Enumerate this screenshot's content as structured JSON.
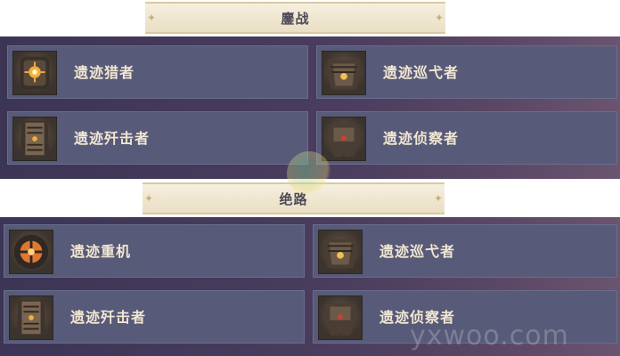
{
  "sections": [
    {
      "title": "鏖战",
      "items": [
        {
          "label": "遗迹猎者",
          "icon": "ruin-hunter-icon"
        },
        {
          "label": "遗迹巡弋者",
          "icon": "ruin-cruiser-icon"
        },
        {
          "label": "遗迹歼击者",
          "icon": "ruin-destroyer-icon"
        },
        {
          "label": "遗迹侦察者",
          "icon": "ruin-scout-icon"
        }
      ]
    },
    {
      "title": "绝路",
      "items": [
        {
          "label": "遗迹重机",
          "icon": "ruin-grader-icon"
        },
        {
          "label": "遗迹巡弋者",
          "icon": "ruin-cruiser-icon"
        },
        {
          "label": "遗迹歼击者",
          "icon": "ruin-destroyer-icon"
        },
        {
          "label": "遗迹侦察者",
          "icon": "ruin-scout-icon"
        }
      ]
    }
  ],
  "watermark": "yxwoo.com"
}
